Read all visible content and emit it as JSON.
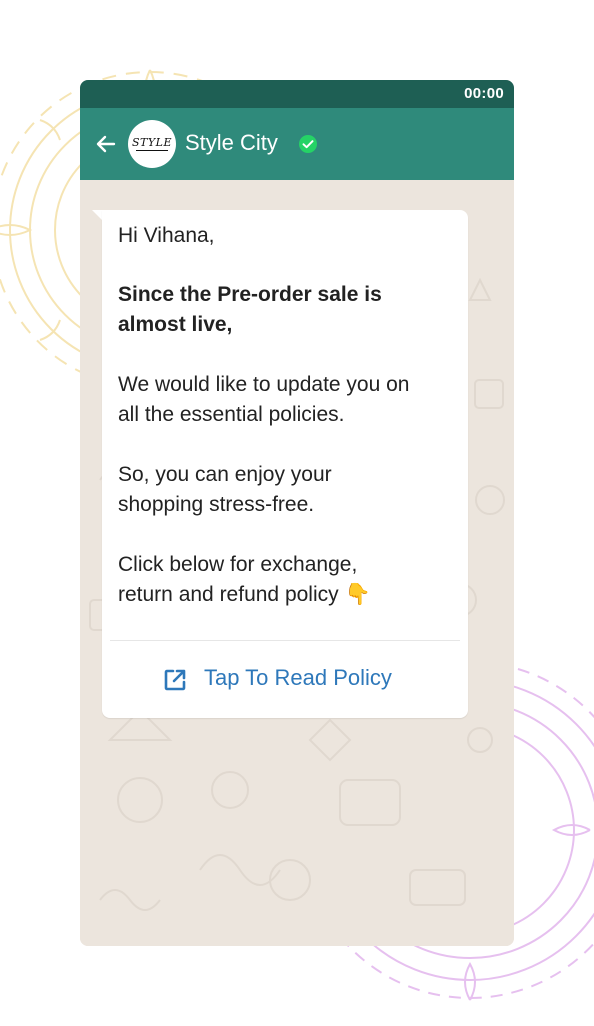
{
  "status_bar": {
    "time": "00:00"
  },
  "header": {
    "avatar_text": "STYLE",
    "contact_name": "Style City",
    "verified": true
  },
  "message": {
    "greeting": "Hi Vihana,",
    "headline": "Since the Pre-order sale is\nalmost live,",
    "paragraph_1": "We would like to update you on\nall the essential policies.",
    "paragraph_2": "So, you can enjoy your\nshopping stress-free.",
    "paragraph_3": "Click below for exchange,\nreturn and refund policy 👇",
    "cta_label": "Tap To Read Policy"
  },
  "colors": {
    "status_bar": "#1e5f54",
    "header": "#2f8a7b",
    "chat_background": "#ece5dd",
    "cta_text": "#2e78ba",
    "verified_badge": "#25d366",
    "mandala_yellow": "#f5e4b3",
    "mandala_pink": "#e6c0ef"
  },
  "icons": {
    "back": "arrow-left-icon",
    "verified": "check-circle-icon",
    "cta": "external-link-icon"
  }
}
